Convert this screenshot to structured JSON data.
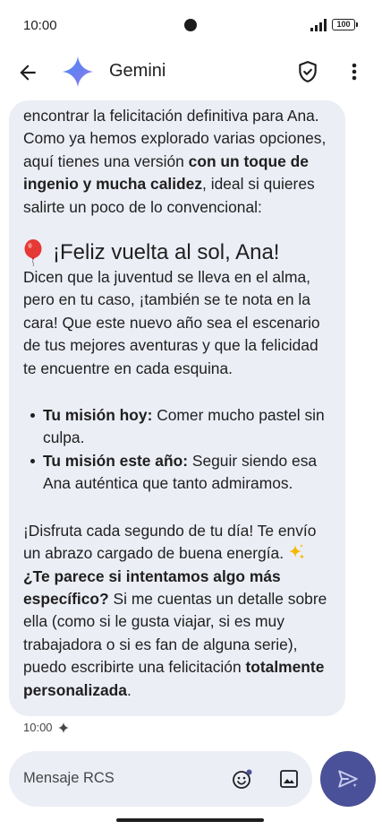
{
  "status_bar": {
    "time": "10:00",
    "battery": "100"
  },
  "header": {
    "title": "Gemini"
  },
  "message": {
    "intro_prefix": "encontrar la felicitación definitiva para Ana. Como ya hemos explorado varias opciones, aquí tienes una versión ",
    "intro_bold": "con un toque de ingenio y mucha calidez",
    "intro_suffix": ", ideal si quieres salirte un poco de lo convencional:",
    "title": "¡Feliz vuelta al sol, Ana!",
    "paragraph": "Dicen que la juventud se lleva en el alma, pero en tu caso, ¡también se te nota en la cara! Que este nuevo año sea el escenario de tus mejores aventuras y que la felicidad te encuentre en cada esquina.",
    "bullets": [
      {
        "bold": "Tu misión hoy:",
        "text": " Comer mucho pastel sin culpa."
      },
      {
        "bold": "Tu misión este año:",
        "text": " Seguir siendo esa Ana auténtica que tanto admiramos."
      }
    ],
    "closing": "¡Disfruta cada segundo de tu día! Te envío un abrazo cargado de buena energía. ",
    "question_bold": "¿Te parece si intentamos algo más específico?",
    "question_text": " Si me cuentas un detalle sobre ella (como si le gusta viajar, si es muy trabajadora o si es fan de alguna serie), puedo escribirte una felicitación ",
    "question_bold_end": "totalmente personalizada",
    "question_end": ".",
    "time": "10:00"
  },
  "composer": {
    "placeholder": "Mensaje RCS"
  },
  "icons": {
    "back": "back-arrow-icon",
    "logo": "gemini-sparkle-icon",
    "shield": "verified-shield-icon",
    "more": "more-vert-icon",
    "balloon": "balloon-icon",
    "sparkles": "sparkles-icon",
    "emoji": "emoji-icon",
    "gallery": "gallery-icon",
    "send": "send-icon"
  },
  "colors": {
    "bubble": "#eceef6",
    "send": "#4b5198",
    "balloon": "#e53935"
  }
}
